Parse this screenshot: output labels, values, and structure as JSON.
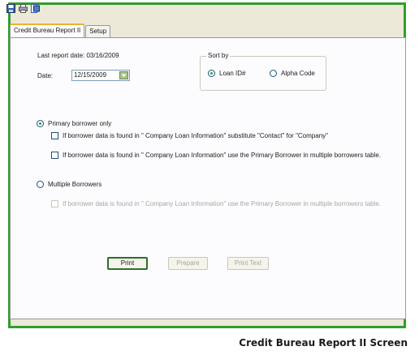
{
  "toolbar": {
    "icons": [
      "save-icon",
      "print-icon",
      "export-icon"
    ]
  },
  "tabs": [
    {
      "label": "Credit Bureau Report II",
      "active": true
    },
    {
      "label": "Setup",
      "active": false
    }
  ],
  "report": {
    "last_report": "Last report date: 03/16/2009",
    "date_label": "Date:",
    "date_value": "12/15/2009"
  },
  "sort": {
    "title": "Sort by",
    "options": [
      {
        "label": "Loan ID#",
        "selected": true
      },
      {
        "label": "Alpha Code",
        "selected": false
      }
    ]
  },
  "borrower": {
    "primary_label": "Primary borrower only",
    "primary_selected": true,
    "primary_opt1": "If borrower data is found in \" Company Loan Information\" substitute \"Contact\" for \"Company\"",
    "primary_opt2": "If borrower data is found in \" Company Loan Information\" use the Primary Borrower in multiple borrowers table.",
    "multiple_label": "Multiple Borrowers",
    "multiple_selected": false,
    "multiple_opt1": "If borrower data is found in \" Company Loan Information\" use the Primary Borrower in multiple borrowers table."
  },
  "buttons": {
    "print": "Print",
    "prepare": "Prepare",
    "print_text": "Print Text"
  },
  "caption": "Credit Bureau Report II Screen",
  "colors": {
    "frame": "#2e9e2e",
    "tab_highlight": "#f0b030",
    "window_bg": "#ece9d8"
  }
}
